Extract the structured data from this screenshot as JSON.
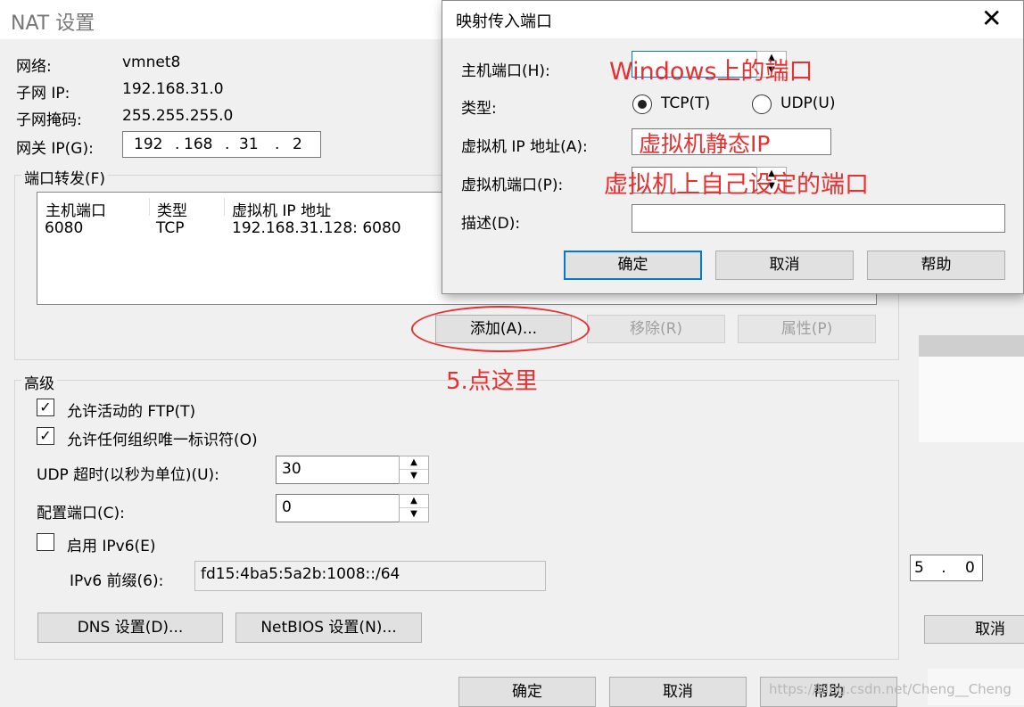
{
  "nat": {
    "title": "NAT 设置",
    "network_label": "网络:",
    "network_value": "vmnet8",
    "subnet_ip_label": "子网 IP:",
    "subnet_ip_value": "192.168.31.0",
    "mask_label": "子网掩码:",
    "mask_value": "255.255.255.0",
    "gateway_label": "网关 IP(G):",
    "gateway_octets": [
      "192",
      "168",
      "31",
      "2"
    ],
    "port_forward": {
      "title": "端口转发(F)",
      "columns": [
        "主机端口",
        "类型",
        "虚拟机 IP 地址"
      ],
      "rows": [
        {
          "host_port": "6080",
          "type": "TCP",
          "vm_addr": "192.168.31.128: 6080"
        }
      ],
      "add_button": "添加(A)...",
      "remove_button": "移除(R)",
      "props_button": "属性(P)"
    },
    "advanced": {
      "title": "高级",
      "allow_ftp": "允许活动的 FTP(T)",
      "allow_uid": "允许任何组织唯一标识符(O)",
      "udp_label": "UDP 超时(以秒为单位)(U):",
      "udp_value": "30",
      "config_port_label": "配置端口(C):",
      "config_port_value": "0",
      "ipv6_label": "启用 IPv6(E)",
      "ipv6_prefix_label": "IPv6 前缀(6):",
      "ipv6_prefix_value": "fd15:4ba5:5a2b:1008::/64"
    },
    "dns_button": "DNS 设置(D)...",
    "netbios_button": "NetBIOS 设置(N)...",
    "ok": "确定",
    "cancel": "取消",
    "help": "帮助"
  },
  "background": {
    "partial_octet": "5",
    "partial_octet2": "0",
    "cancel": "取消"
  },
  "dialog": {
    "title": "映射传入端口",
    "host_port_label": "主机端口(H):",
    "type_label": "类型:",
    "tcp_label": "TCP(T)",
    "udp_label": "UDP(U)",
    "vm_ip_label": "虚拟机 IP 地址(A):",
    "vm_port_label": "虚拟机端口(P):",
    "desc_label": "描述(D):",
    "ok": "确定",
    "cancel": "取消",
    "help": "帮助",
    "selected_type": "TCP"
  },
  "annotations": {
    "host_port_note": "Windows上的端口",
    "vm_ip_note": "虚拟机静态IP",
    "vm_port_note": "虚拟机上自己设定的端口",
    "step_note": "5.点这里",
    "color": "#e83030"
  },
  "watermark": "https://blog.csdn.net/Cheng__Cheng"
}
